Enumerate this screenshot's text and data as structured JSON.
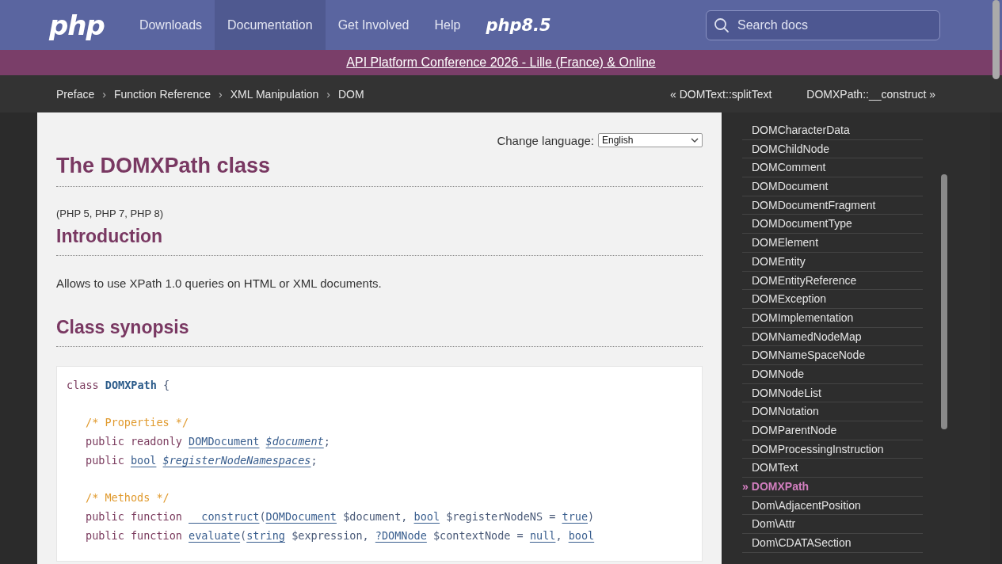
{
  "header": {
    "logo": "php",
    "nav": [
      {
        "label": "Downloads",
        "selected": false
      },
      {
        "label": "Documentation",
        "selected": true
      },
      {
        "label": "Get Involved",
        "selected": false
      },
      {
        "label": "Help",
        "selected": false
      }
    ],
    "release_badge": "php8.5",
    "search": {
      "placeholder": "Search docs"
    }
  },
  "banner": {
    "link": "API Platform Conference 2026 - Lille (France) & Online"
  },
  "breadcrumbs": [
    "Preface",
    "Function Reference",
    "XML Manipulation",
    "DOM"
  ],
  "breadcrumb_separator": "›",
  "pager": {
    "previous": "« DOMText::splitText",
    "next": "DOMXPath::__construct »"
  },
  "content": {
    "language": {
      "label": "Change language:",
      "value": "English"
    },
    "title": "The DOMXPath class",
    "versions": "(PHP 5, PHP 7, PHP 8)",
    "intro_heading": "Introduction",
    "intro_text": "Allows to use XPath 1.0 queries on HTML or XML documents.",
    "synopsis_heading": "Class synopsis",
    "code": {
      "header": [
        {
          "kind": "keyword",
          "text": "class "
        },
        {
          "kind": "classname",
          "text": "DOMXPath"
        },
        {
          "kind": "plain",
          "text": " {"
        }
      ],
      "groups": [
        {
          "comment": "/* Properties */",
          "lines": [
            [
              {
                "kind": "keyword",
                "text": "public readonly "
              },
              {
                "kind": "type",
                "text": "DOMDocument"
              },
              {
                "kind": "var",
                "text": "$document",
                "spaced": true
              },
              {
                "kind": "plain",
                "text": ";"
              }
            ],
            [
              {
                "kind": "keyword",
                "text": "public "
              },
              {
                "kind": "type",
                "text": "bool"
              },
              {
                "kind": "var",
                "text": "$registerNodeNamespaces",
                "spaced": true
              },
              {
                "kind": "plain",
                "text": ";"
              }
            ]
          ]
        },
        {
          "comment": "/* Methods */",
          "lines": [
            [
              {
                "kind": "keyword",
                "text": "public function "
              },
              {
                "kind": "type",
                "text": "__construct"
              },
              {
                "kind": "plain",
                "text": "("
              },
              {
                "kind": "type",
                "text": "DOMDocument"
              },
              {
                "kind": "plain",
                "text": " $document, "
              },
              {
                "kind": "type",
                "text": "bool"
              },
              {
                "kind": "plain",
                "text": " $registerNodeNS = "
              },
              {
                "kind": "type",
                "text": "true"
              },
              {
                "kind": "plain",
                "text": ")"
              }
            ],
            [
              {
                "kind": "keyword",
                "text": "public function "
              },
              {
                "kind": "type",
                "text": "evaluate"
              },
              {
                "kind": "plain",
                "text": "("
              },
              {
                "kind": "type",
                "text": "string"
              },
              {
                "kind": "plain",
                "text": " $expression, "
              },
              {
                "kind": "type",
                "text": "?DOMNode"
              },
              {
                "kind": "plain",
                "text": " $contextNode = "
              },
              {
                "kind": "type",
                "text": "null"
              },
              {
                "kind": "plain",
                "text": ", "
              },
              {
                "kind": "type",
                "text": "bool"
              }
            ]
          ]
        }
      ]
    }
  },
  "sidebar": {
    "current_marker": "»",
    "items": [
      {
        "label": "DOMCharacterData",
        "selected": false
      },
      {
        "label": "DOMChildNode",
        "selected": false
      },
      {
        "label": "DOMComment",
        "selected": false
      },
      {
        "label": "DOMDocument",
        "selected": false
      },
      {
        "label": "DOMDocumentFragment",
        "selected": false
      },
      {
        "label": "DOMDocumentType",
        "selected": false
      },
      {
        "label": "DOMElement",
        "selected": false
      },
      {
        "label": "DOMEntity",
        "selected": false
      },
      {
        "label": "DOMEntityReference",
        "selected": false
      },
      {
        "label": "DOMException",
        "selected": false
      },
      {
        "label": "DOMImplementation",
        "selected": false
      },
      {
        "label": "DOMNamedNodeMap",
        "selected": false
      },
      {
        "label": "DOMNameSpaceNode",
        "selected": false
      },
      {
        "label": "DOMNode",
        "selected": false
      },
      {
        "label": "DOMNodeList",
        "selected": false
      },
      {
        "label": "DOMNotation",
        "selected": false
      },
      {
        "label": "DOMParentNode",
        "selected": false
      },
      {
        "label": "DOMProcessingInstruction",
        "selected": false
      },
      {
        "label": "DOMText",
        "selected": false
      },
      {
        "label": "DOMXPath",
        "selected": true
      },
      {
        "label": "Dom\\AdjacentPosition",
        "selected": false
      },
      {
        "label": "Dom\\Attr",
        "selected": false
      },
      {
        "label": "Dom\\CDATASection",
        "selected": false
      }
    ]
  }
}
